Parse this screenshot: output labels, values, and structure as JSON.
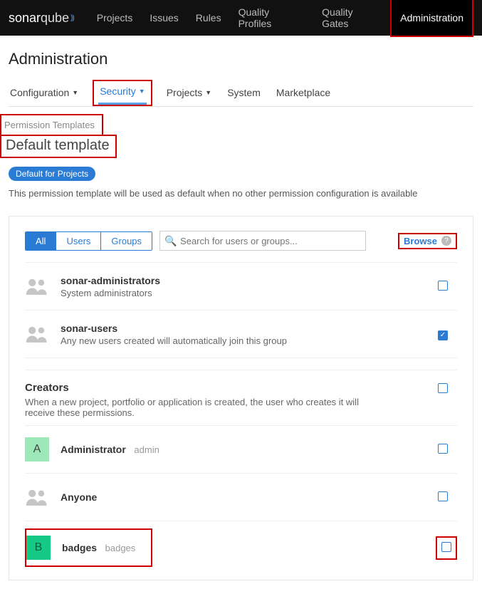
{
  "topnav": {
    "logo_a": "sonar",
    "logo_b": "qube",
    "items": [
      "Projects",
      "Issues",
      "Rules",
      "Quality Profiles",
      "Quality Gates",
      "Administration"
    ],
    "active_index": 5
  },
  "page_title": "Administration",
  "subnav": {
    "items": [
      "Configuration",
      "Security",
      "Projects",
      "System",
      "Marketplace"
    ],
    "caret_indices": [
      0,
      1,
      2
    ],
    "active_index": 1
  },
  "breadcrumb": "Permission Templates",
  "template_title": "Default template",
  "default_pill": "Default for Projects",
  "template_desc": "This permission template will be used as default when no other permission configuration is available",
  "filter_tabs": {
    "items": [
      "All",
      "Users",
      "Groups"
    ],
    "active_index": 0
  },
  "search": {
    "placeholder": "Search for users or groups..."
  },
  "browse_label": "Browse",
  "rows": [
    {
      "kind": "group",
      "title": "sonar-administrators",
      "sub": "System administrators",
      "checked": false
    },
    {
      "kind": "group",
      "title": "sonar-users",
      "sub": "Any new users created will automatically join this group",
      "checked": true
    }
  ],
  "creators": {
    "title": "Creators",
    "desc": "When a new project, portfolio or application is created, the user who creates it will receive these permissions.",
    "checked": false
  },
  "list2": [
    {
      "kind": "letter",
      "letter": "A",
      "bg": "#9de8b9",
      "title": "Administrator",
      "login": "admin",
      "checked": false
    },
    {
      "kind": "group",
      "title": "Anyone",
      "checked": false
    },
    {
      "kind": "letter",
      "letter": "B",
      "bg": "#17c986",
      "title": "badges",
      "login": "badges",
      "checked": false
    }
  ]
}
